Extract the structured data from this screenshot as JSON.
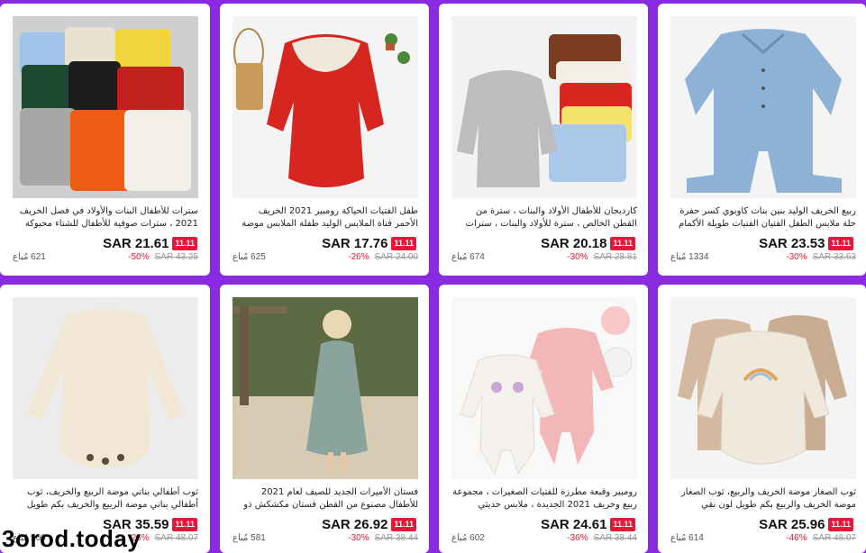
{
  "products": [
    {
      "title": "سترات للأطفال البنات والأولاد في فصل الخريف 2021 ، سترات صوفية للأطفال للشتاء محبوكة مع قاع ، سترات...",
      "price": "SAR 21.61",
      "badge": "11.11",
      "discount": "-50%",
      "original_price": "SAR 43.25",
      "sold": "621 مُباع"
    },
    {
      "title": "طفل الفتيات الحياكة رومبير 2021 الخريف الأحمر فتاة الملابس الوليد طفلة الملابس موضة محبوك رومبير وزرة...",
      "price": "SAR 17.76",
      "badge": "11.11",
      "discount": "-26%",
      "original_price": "SAR 24.00",
      "sold": "625 مُباع"
    },
    {
      "title": "كارديجان للأطفال الأولاد والبنات ، سترة من القطن الخالص ، سترة للأولاد والبنات ، سترات منسوجة للأطفال",
      "price": "SAR 20.18",
      "badge": "11.11",
      "discount": "-30%",
      "original_price": "SAR 28.81",
      "sold": "674 مُباع"
    },
    {
      "title": "ربيع الخريف الوليد بنين بنات كاوبوي كسر حفرة حلة ملابس الطفل الفتيان الفتيات طويلة الأكمام السروال القصير الأطفال...",
      "price": "SAR 23.53",
      "badge": "11.11",
      "discount": "-30%",
      "original_price": "SAR 33.63",
      "sold": "1334 مُباع"
    },
    {
      "title": "ثوب أطفالي بناتي موضة الربيع والخريف، ثوب أطفالي بناتي موضة الربيع والخريف بكم طويل ثوب حياكة ثوب مجوف...",
      "price": "SAR 35.59",
      "badge": "11.11",
      "discount": "-26%",
      "original_price": "SAR 48.07",
      "sold": "506 مُباع"
    },
    {
      "title": "فستان الأميرات الجديد للصيف لعام 2021 للأطفال مصنوع من القطن فستان مكشكش ذو لون نقي ملابس بناتي بتصميم...",
      "price": "SAR 26.92",
      "badge": "11.11",
      "discount": "-30%",
      "original_price": "SAR 38.44",
      "sold": "581 مُباع"
    },
    {
      "title": "رومبير وقبعة مطرزة للفتيات الصغيرات ، مجموعة ربيع وخريف 2021 الجديدة ، ملابس حديثي الولادة",
      "price": "SAR 24.61",
      "badge": "11.11",
      "discount": "-36%",
      "original_price": "SAR 38.44",
      "sold": "602 مُباع"
    },
    {
      "title": "ثوب الصغار موضة الخريف والربيع، ثوب الصغار موضة الخريف والربيع بكم طويل لون نقي للصبيان والبنات",
      "price": "SAR 25.96",
      "badge": "11.11",
      "discount": "-46%",
      "original_price": "SAR 48.07",
      "sold": "614 مُباع"
    }
  ],
  "watermark": "3orod.today",
  "colors": {
    "background": "#8a2be2",
    "badge": "#e5173a",
    "discount": "#e5173a"
  }
}
